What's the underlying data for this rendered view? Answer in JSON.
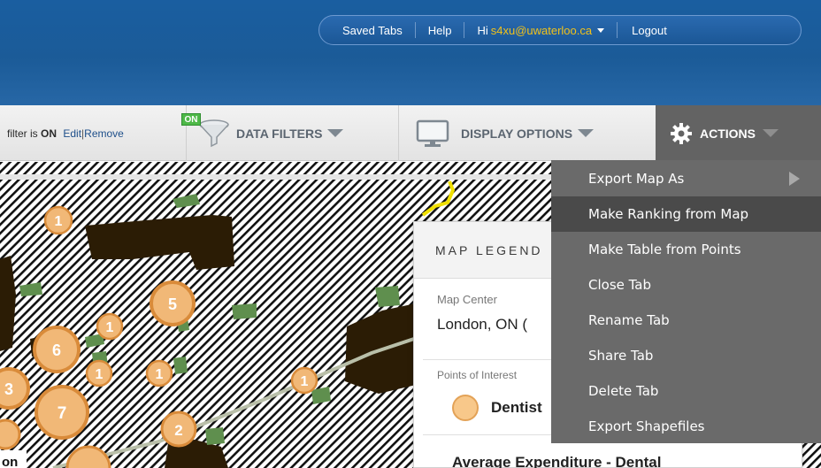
{
  "header": {
    "saved_tabs": "Saved Tabs",
    "help": "Help",
    "hi": "Hi",
    "email": "s4xu@uwaterloo.ca",
    "logout": "Logout"
  },
  "toolbar": {
    "filter_prefix": "filter is",
    "filter_state": "ON",
    "edit": "Edit",
    "separator": "|",
    "remove": "Remove",
    "on_badge": "ON",
    "data_filters": "DATA FILTERS",
    "display_options": "DISPLAY OPTIONS",
    "actions": "ACTIONS"
  },
  "actions_menu": {
    "items": [
      {
        "label": "Export Map As",
        "has_submenu": true
      },
      {
        "label": "Make Ranking from Map",
        "active": true
      },
      {
        "label": "Make Table from Points"
      },
      {
        "label": "Close Tab"
      },
      {
        "label": "Rename Tab"
      },
      {
        "label": "Share Tab"
      },
      {
        "label": "Delete Tab"
      },
      {
        "label": "Export Shapefiles"
      }
    ]
  },
  "legend": {
    "title": "MAP LEGEND",
    "map_center_label": "Map Center",
    "map_center_value": "London, ON (",
    "poi_label": "Points of Interest",
    "poi_value": "Dentist",
    "expenditure_title": "Average Expenditure - Dental"
  },
  "map": {
    "poi_clusters": [
      {
        "count": "1"
      },
      {
        "count": "5"
      },
      {
        "count": "1"
      },
      {
        "count": "6"
      },
      {
        "count": "1"
      },
      {
        "count": "1"
      },
      {
        "count": "1"
      },
      {
        "count": "3"
      },
      {
        "count": "7"
      },
      {
        "count": "2"
      }
    ],
    "corner_label": "on",
    "colors": {
      "hatch": "#111111",
      "building": "#2b1c05",
      "park": "#5f8f4e",
      "poi_fill": "#f1b877",
      "poi_stroke": "#d98b3a",
      "road": "#b9bfa9",
      "highlight": "#f0e000"
    }
  },
  "colors": {
    "header_blue": "#1b5b98",
    "email_yellow": "#f2c21a",
    "actions_bg": "#636363",
    "menu_bg": "#6a6a6a",
    "menu_active": "#4a4a4a",
    "on_green": "#4eb848"
  }
}
